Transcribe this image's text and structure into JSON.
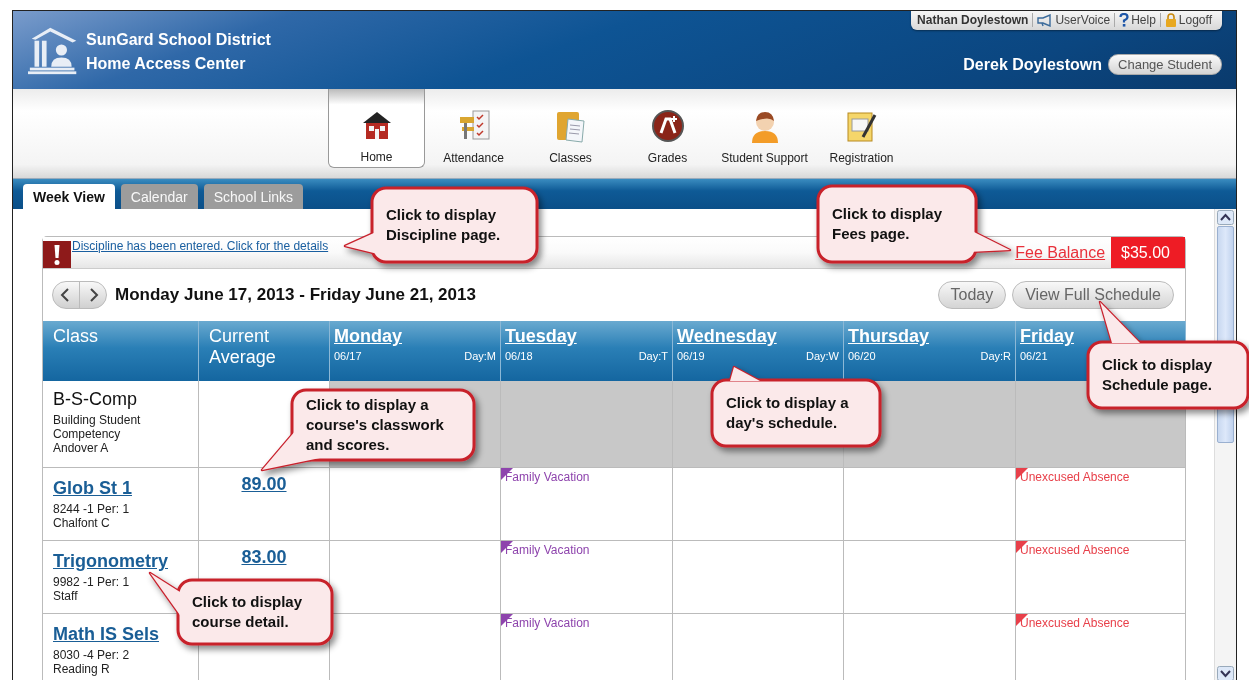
{
  "header": {
    "district": "SunGard School District",
    "app": "Home Access Center",
    "user": "Nathan Doylestown",
    "links": [
      {
        "label": "UserVoice"
      },
      {
        "label": "Help"
      },
      {
        "label": "Logoff"
      }
    ],
    "student": "Derek Doylestown",
    "change_button": "Change Student"
  },
  "nav": [
    {
      "label": "Home",
      "selected": true
    },
    {
      "label": "Attendance",
      "selected": false
    },
    {
      "label": "Classes",
      "selected": false
    },
    {
      "label": "Grades",
      "selected": false
    },
    {
      "label": "Student Support",
      "selected": false
    },
    {
      "label": "Registration",
      "selected": false
    }
  ],
  "tabs": [
    {
      "label": "Week View",
      "selected": true
    },
    {
      "label": "Calendar",
      "selected": false
    },
    {
      "label": "School Links",
      "selected": false
    }
  ],
  "alert": {
    "text": "Discipline has been entered. Click for the details",
    "fee_label": "Fee Balance",
    "fee_amount": "$35.00"
  },
  "week": {
    "title": "Monday June 17, 2013 - Friday June 21, 2013",
    "buttons": [
      "Today",
      "View Full Schedule"
    ]
  },
  "table": {
    "columns": [
      "Class",
      "Current Average"
    ],
    "days": [
      {
        "name": "Monday",
        "date": "06/17",
        "day": "Day:M"
      },
      {
        "name": "Tuesday",
        "date": "06/18",
        "day": "Day:T"
      },
      {
        "name": "Wednesday",
        "date": "06/19",
        "day": "Day:W"
      },
      {
        "name": "Thursday",
        "date": "06/20",
        "day": "Day:R"
      },
      {
        "name": "Friday",
        "date": "06/21"
      }
    ],
    "rows": [
      {
        "kind": "unscheduled",
        "name": "B-S-Comp",
        "lines": [
          "Building Student",
          "Competency",
          "Andover A"
        ]
      },
      {
        "kind": "course",
        "name": "Glob St 1",
        "lines": [
          "8244 -1 Per: 1",
          "Chalfont C"
        ],
        "average": "89.00",
        "cells": [
          {
            "kind": "empty"
          },
          {
            "kind": "event",
            "text": "Family Vacation",
            "color": "#8e44ad"
          },
          {
            "kind": "empty"
          },
          {
            "kind": "empty"
          },
          {
            "kind": "event",
            "text": "Unexcused Absence",
            "color": "#e8404a"
          }
        ]
      },
      {
        "kind": "course",
        "name": "Trigonometry",
        "lines": [
          "9982 -1 Per: 1",
          "Staff"
        ],
        "average": "83.00",
        "cells": [
          {
            "kind": "empty"
          },
          {
            "kind": "event",
            "text": "Family Vacation",
            "color": "#8e44ad"
          },
          {
            "kind": "empty"
          },
          {
            "kind": "empty"
          },
          {
            "kind": "event",
            "text": "Unexcused Absence",
            "color": "#e8404a"
          }
        ]
      },
      {
        "kind": "course",
        "name": "Math IS Sels",
        "lines": [
          "8030 -4 Per: 2",
          "Reading R"
        ],
        "cells": [
          {
            "kind": "empty"
          },
          {
            "kind": "event",
            "text": "Family Vacation",
            "color": "#8e44ad"
          },
          {
            "kind": "empty"
          },
          {
            "kind": "empty"
          },
          {
            "kind": "event",
            "text": "Unexcused Absence",
            "color": "#e8404a"
          }
        ]
      }
    ]
  },
  "callouts": [
    {
      "lines": [
        "Click to display",
        "Discipline page."
      ]
    },
    {
      "lines": [
        "Click to display",
        "Fees page."
      ]
    },
    {
      "lines": [
        "Click to display a",
        "course's classwork",
        "and scores."
      ]
    },
    {
      "lines": [
        "Click to display a",
        "day's schedule."
      ]
    },
    {
      "lines": [
        "Click to display",
        "Schedule page."
      ]
    },
    {
      "lines": [
        "Click to display",
        "course detail."
      ]
    }
  ]
}
